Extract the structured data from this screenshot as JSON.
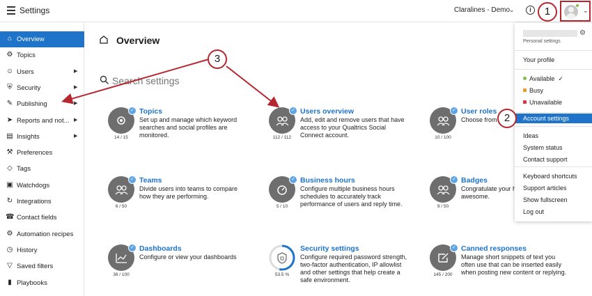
{
  "app": {
    "title": "Settings"
  },
  "header": {
    "account_name": "Claralines - Demo"
  },
  "sidebar": {
    "items": [
      {
        "label": "Overview",
        "icon": "home-icon",
        "active": true
      },
      {
        "label": "Topics",
        "icon": "gear-icon"
      },
      {
        "label": "Users",
        "icon": "users-icon",
        "submenu": true
      },
      {
        "label": "Security",
        "icon": "shield-icon",
        "submenu": true
      },
      {
        "label": "Publishing",
        "icon": "edit-icon",
        "submenu": true
      },
      {
        "label": "Reports and not...",
        "icon": "send-icon",
        "submenu": true
      },
      {
        "label": "Insights",
        "icon": "chart-icon",
        "submenu": true
      },
      {
        "label": "Preferences",
        "icon": "wrench-icon"
      },
      {
        "label": "Tags",
        "icon": "tag-icon"
      },
      {
        "label": "Watchdogs",
        "icon": "watchdog-icon"
      },
      {
        "label": "Integrations",
        "icon": "refresh-icon"
      },
      {
        "label": "Contact fields",
        "icon": "contact-icon"
      },
      {
        "label": "Automation recipes",
        "icon": "gears-icon"
      },
      {
        "label": "History",
        "icon": "clock-icon"
      },
      {
        "label": "Saved filters",
        "icon": "filter-icon"
      },
      {
        "label": "Playbooks",
        "icon": "book-icon"
      }
    ]
  },
  "main": {
    "title": "Overview",
    "search_placeholder": "Search settings",
    "cards": [
      {
        "title": "Topics",
        "desc": "Set up and manage which keyword searches and social profiles are monitored.",
        "badge": "14 / 15"
      },
      {
        "title": "Users overview",
        "desc": "Add, edit and remove users that have access to your Qualtrics Social Connect account.",
        "badge": "112 / 112"
      },
      {
        "title": "User roles",
        "desc": "Choose from or create your own roles.",
        "badge": "10 / 100"
      },
      {
        "title": "Teams",
        "desc": "Divide users into teams to compare how they are performing.",
        "badge": "6 / 50"
      },
      {
        "title": "Business hours",
        "desc": "Configure multiple business hours schedules to accurately track performance of users and reply time.",
        "badge": "5 / 10"
      },
      {
        "title": "Badges",
        "desc": "Congratulate your hand out badges be awesome.",
        "badge": "9 / 50"
      },
      {
        "title": "Dashboards",
        "desc": "Configure or view your dashboards",
        "badge": "38 / 100"
      },
      {
        "title": "Security settings",
        "desc": "Configure required password strength, two-factor authentication, IP allowlist and other settings that help create a safe environment.",
        "badge": "53.5 %",
        "progress": 0.535
      },
      {
        "title": "Canned responses",
        "desc": "Manage short snippets of text you often use that can be inserted easily when posting new content or replying.",
        "badge": "145 / 200"
      }
    ]
  },
  "menu": {
    "subtitle": "Personal settings",
    "profile": "Your profile",
    "statuses": [
      {
        "label": "Available",
        "color": "#7cc13f",
        "checked": true
      },
      {
        "label": "Busy",
        "color": "#f0962a"
      },
      {
        "label": "Unavailable",
        "color": "#e0334a"
      }
    ],
    "account_settings": "Account settings",
    "links_a": [
      "Ideas",
      "System status",
      "Contact support"
    ],
    "links_b": [
      "Keyboard shortcuts",
      "Support articles",
      "Show fullscreen",
      "Log out"
    ]
  },
  "callouts": [
    "1",
    "2",
    "3"
  ],
  "colors": {
    "accent": "#1f74c9",
    "callout": "#b5262f",
    "icon_gray": "#6e6e6e"
  }
}
